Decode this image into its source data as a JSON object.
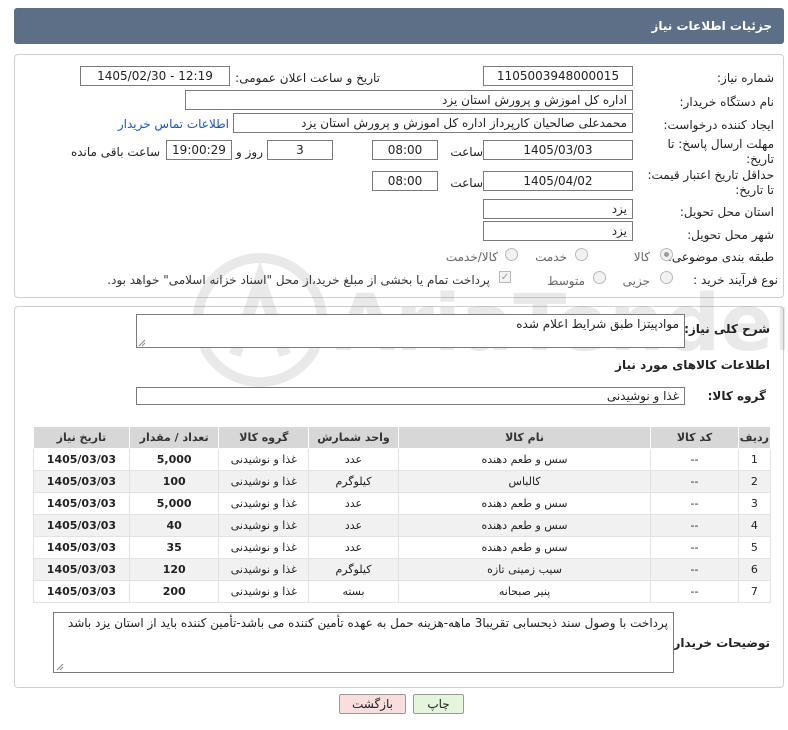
{
  "header": {
    "title": "جزئیات اطلاعات نیاز"
  },
  "form": {
    "need_number_label": "شماره نیاز:",
    "need_number": "1105003948000015",
    "announce_label": "تاریخ و ساعت اعلان عمومی:",
    "announce_value": "1405/02/30 - 12:19",
    "buyer_org_label": "نام دستگاه خریدار:",
    "buyer_org": "اداره کل اموزش و پرورش استان یزد",
    "creator_label": "ایجاد کننده درخواست:",
    "creator": "محمدعلی صالحیان کارپرداز اداره کل اموزش و پرورش استان یزد",
    "contact_link": "اطلاعات تماس خریدار",
    "deadline_label_1": "مهلت ارسال پاسخ: تا",
    "deadline_label_2": "تاریخ:",
    "deadline_date": "1405/03/03",
    "time_label": "ساعت",
    "deadline_time": "08:00",
    "days_value": "3",
    "days_label": "روز و",
    "remaining_time": "19:00:29",
    "remaining_label": "ساعت باقی مانده",
    "validity_label_1": "حداقل تاریخ اعتبار قیمت:",
    "validity_label_2": "تا تاریخ:",
    "validity_date": "1405/04/02",
    "validity_time": "08:00",
    "province_label": "استان محل تحویل:",
    "province": "یزد",
    "city_label": "شهر محل تحویل:",
    "city": "یزد",
    "category_label": "طبقه بندی موضوعی:",
    "category_options": [
      "کالا",
      "خدمت",
      "کالا/خدمت"
    ],
    "process_label": "نوع فرآیند خرید :",
    "process_options": [
      "جزیی",
      "متوسط"
    ],
    "payment_note": "پرداخت تمام یا بخشی از مبلغ خرید،از محل \"اسناد خزانه اسلامی\" خواهد بود."
  },
  "details": {
    "summary_label": "شرح کلی نیاز:",
    "summary": "موادپیتزا طبق شرایط اعلام شده",
    "goods_info_title": "اطلاعات کالاهای مورد نیاز",
    "goods_group_label": "گروه کالا:",
    "goods_group": "غذا و نوشیدنی",
    "table": {
      "headers": [
        "ردیف",
        "کد کالا",
        "نام کالا",
        "واحد شمارش",
        "گروه کالا",
        "تعداد / مقدار",
        "تاریخ نیاز"
      ],
      "rows": [
        [
          "1",
          "--",
          "سس و طعم دهنده",
          "عدد",
          "غذا و نوشیدنی",
          "5,000",
          "1405/03/03"
        ],
        [
          "2",
          "--",
          "کالباس",
          "کیلوگرم",
          "غذا و نوشیدنی",
          "100",
          "1405/03/03"
        ],
        [
          "3",
          "--",
          "سس و طعم دهنده",
          "عدد",
          "غذا و نوشیدنی",
          "5,000",
          "1405/03/03"
        ],
        [
          "4",
          "--",
          "سس و طعم دهنده",
          "عدد",
          "غذا و نوشیدنی",
          "40",
          "1405/03/03"
        ],
        [
          "5",
          "--",
          "سس و طعم دهنده",
          "عدد",
          "غذا و نوشیدنی",
          "35",
          "1405/03/03"
        ],
        [
          "6",
          "--",
          "سیب زمینی تازه",
          "کیلوگرم",
          "غذا و نوشیدنی",
          "120",
          "1405/03/03"
        ],
        [
          "7",
          "--",
          "پنیر صبحانه",
          "بسته",
          "غذا و نوشیدنی",
          "200",
          "1405/03/03"
        ]
      ]
    },
    "buyer_notes_label": "توضیحات خریدار:",
    "buyer_notes": "پرداخت با وصول سند ذیحسابی تقریبا3 ماهه-هزینه حمل به عهده تأمین کننده می باشد-تأمین کننده باید از استان یزد باشد"
  },
  "buttons": {
    "print": "چاپ",
    "back": "بازگشت"
  },
  "watermark": "AriaTender.net",
  "colors": {
    "header": "#5c6f86",
    "link": "#1a55c4",
    "back_button": "#f9dede",
    "print_button": "#e4f5dc"
  }
}
